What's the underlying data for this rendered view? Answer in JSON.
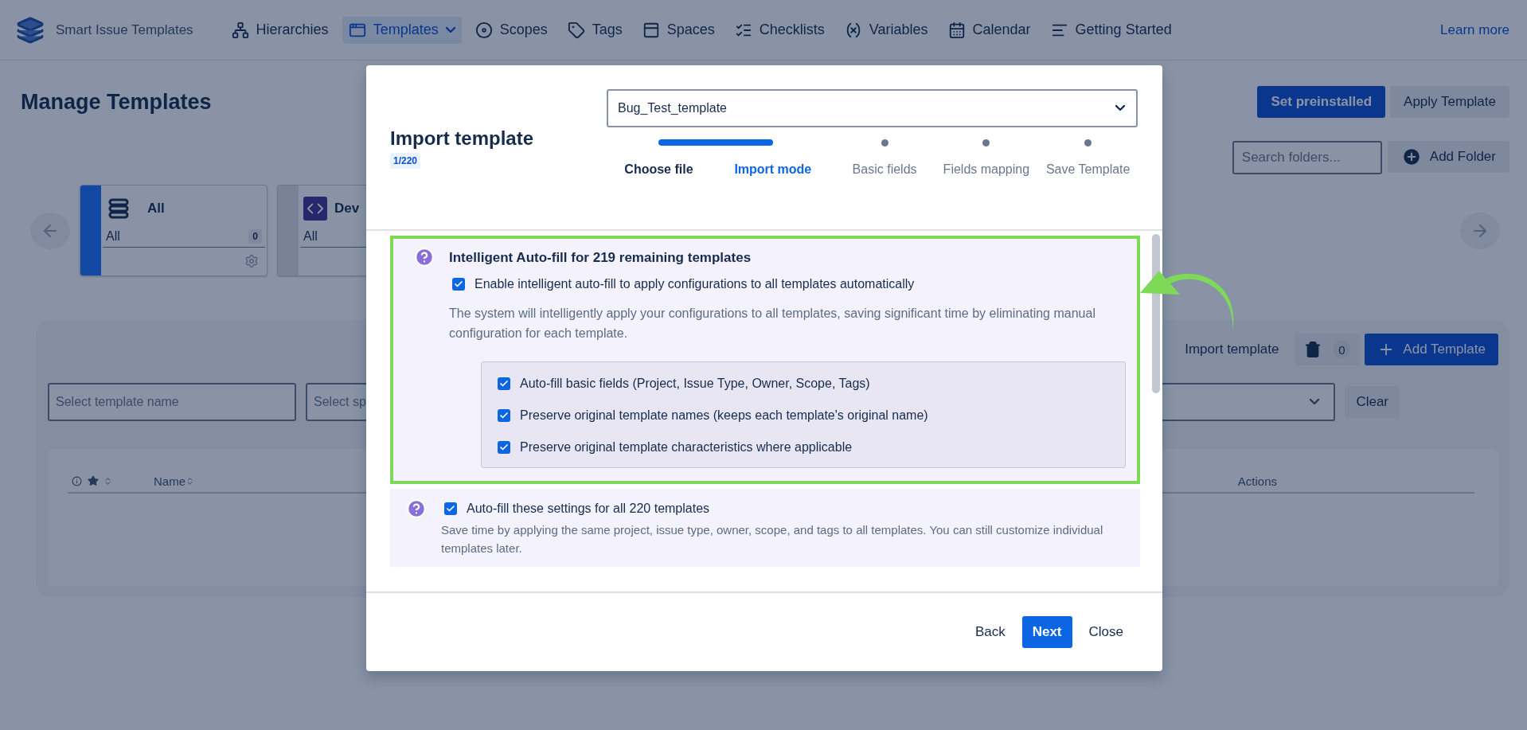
{
  "nav": {
    "brand": "Smart Issue Templates",
    "items": [
      {
        "label": "Hierarchies",
        "selected": false,
        "dropdown": false
      },
      {
        "label": "Templates",
        "selected": true,
        "dropdown": true
      },
      {
        "label": "Scopes",
        "selected": false,
        "dropdown": false
      },
      {
        "label": "Tags",
        "selected": false,
        "dropdown": false
      },
      {
        "label": "Spaces",
        "selected": false,
        "dropdown": false
      },
      {
        "label": "Checklists",
        "selected": false,
        "dropdown": false
      },
      {
        "label": "Variables",
        "selected": false,
        "dropdown": false
      },
      {
        "label": "Calendar",
        "selected": false,
        "dropdown": false
      },
      {
        "label": "Getting Started",
        "selected": false,
        "dropdown": false
      }
    ],
    "link": "Learn more"
  },
  "page": {
    "title": "Manage Templates",
    "actions": [
      {
        "label": "Set preinstalled",
        "kind": "primary"
      },
      {
        "label": "Apply Template",
        "kind": "subtle"
      }
    ],
    "folder_search": {
      "placeholder": "Search folders..."
    },
    "add_folder": "Add Folder",
    "folders": [
      {
        "title": "All",
        "subtitle": "All",
        "count": "0",
        "selected": true
      },
      {
        "title": "Dev",
        "subtitle": "All",
        "selected": false
      }
    ],
    "import_link": "Import template",
    "trash_count": "0",
    "add_template": "Add Template",
    "filters": [
      {
        "placeholder": "Select template name"
      },
      {
        "placeholder": "Select sp"
      }
    ],
    "clear": "Clear",
    "columns": [
      {
        "label": "Name"
      },
      {
        "label": "Actions"
      }
    ]
  },
  "modal": {
    "title": "Import template",
    "badge": "1/220",
    "file": "Bug_Test_template",
    "steps": [
      {
        "label": "Choose file",
        "completed": true,
        "selected": false
      },
      {
        "label": "Import mode",
        "completed": false,
        "selected": true
      },
      {
        "label": "Basic fields",
        "completed": false,
        "selected": false
      },
      {
        "label": "Fields mapping",
        "completed": false,
        "selected": false
      },
      {
        "label": "Save Template",
        "completed": false,
        "selected": false
      }
    ],
    "sections": [
      {
        "kind": "group",
        "highlighted": true,
        "heading": "Intelligent Auto-fill for 219 remaining templates",
        "option": {
          "label": "Enable intelligent auto-fill to apply configurations to all templates automatically",
          "checked": true
        },
        "description": "The system will intelligently apply your configurations to all templates, saving significant time by eliminating manual configuration for each template.",
        "sub_options": [
          {
            "label": "Auto-fill basic fields (Project, Issue Type, Owner, Scope, Tags)",
            "checked": true
          },
          {
            "label": "Preserve original template names (keeps each template's original name)",
            "checked": true
          },
          {
            "label": "Preserve original template characteristics where applicable",
            "checked": true
          }
        ]
      },
      {
        "kind": "simple",
        "highlighted": false,
        "option": {
          "label": "Auto-fill these settings for all 220 templates",
          "checked": true
        },
        "description": "Save time by applying the same project, issue type, owner, scope, and tags to all templates. You can still customize individual templates later."
      }
    ],
    "back": "Back",
    "next": "Next",
    "close": "Close"
  }
}
